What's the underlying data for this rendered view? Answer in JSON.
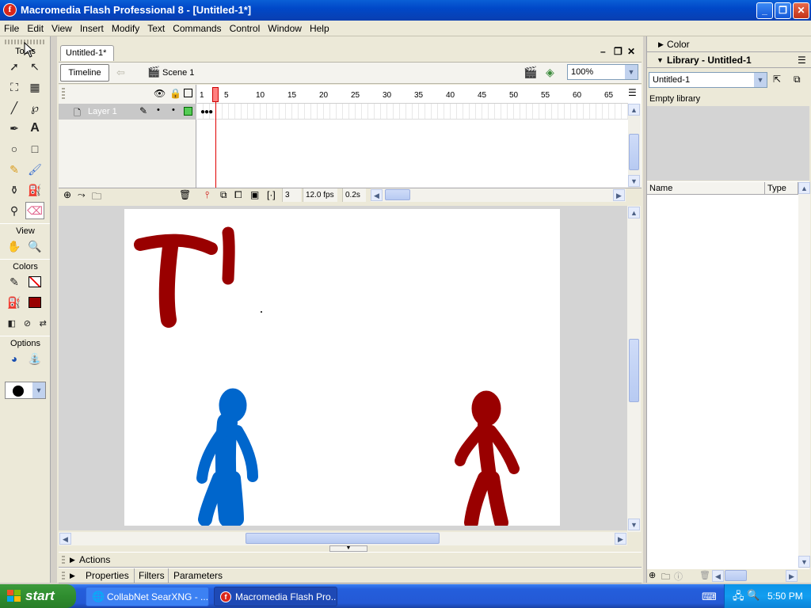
{
  "window": {
    "title": "Macromedia Flash Professional 8 - [Untitled-1*]",
    "app_icon_letter": "f"
  },
  "menu": [
    "File",
    "Edit",
    "View",
    "Insert",
    "Modify",
    "Text",
    "Commands",
    "Control",
    "Window",
    "Help"
  ],
  "tools": {
    "title": "Tools",
    "view_label": "View",
    "colors_label": "Colors",
    "options_label": "Options",
    "stroke_color": "#000000",
    "fill_color": "#990000"
  },
  "document": {
    "tab_label": "Untitled-1*",
    "timeline_button": "Timeline",
    "scene_label": "Scene 1",
    "zoom": "100%"
  },
  "timeline": {
    "layer_name": "Layer 1",
    "frame_numbers": [
      "1",
      "5",
      "10",
      "15",
      "20",
      "25",
      "30",
      "35",
      "40",
      "45",
      "50",
      "55",
      "60",
      "65"
    ],
    "current_frame": "3",
    "fps": "12.0 fps",
    "elapsed": "0.2s"
  },
  "stage": {
    "drawing_colors": {
      "red": "#990000",
      "blue": "#0066cc"
    }
  },
  "bottom_panels": {
    "actions": "Actions",
    "tabs": [
      "Properties",
      "Filters",
      "Parameters"
    ]
  },
  "right_panels": {
    "color_title": "Color",
    "library_title": "Library - Untitled-1",
    "library_select": "Untitled-1",
    "library_status": "Empty library",
    "col_name": "Name",
    "col_type": "Type"
  },
  "taskbar": {
    "start_label": "start",
    "tasks": [
      {
        "label": "CollabNet SearXNG - ...",
        "active": false
      },
      {
        "label": "Macromedia Flash Pro...",
        "active": true
      }
    ],
    "clock": "5:50 PM"
  }
}
